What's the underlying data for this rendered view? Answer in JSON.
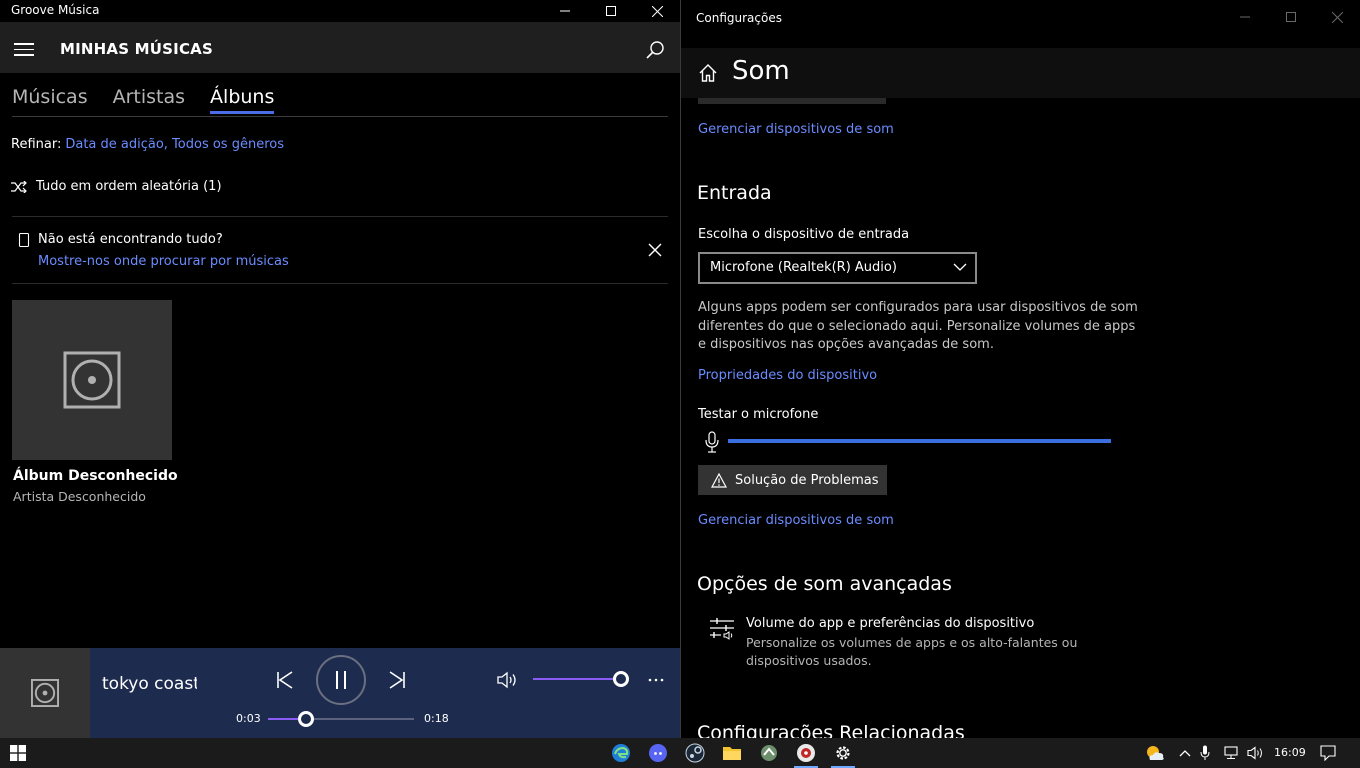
{
  "groove": {
    "window_title": "Groove Música",
    "header_title": "MINHAS MÚSICAS",
    "tabs": [
      "Músicas",
      "Artistas",
      "Álbuns"
    ],
    "refine_label": "Refinar:",
    "refine_value": "Data de adição, Todos os gêneros",
    "shuffle_label": "Tudo em ordem aleatória (1)",
    "notice_question": "Não está encontrando tudo?",
    "notice_link": "Mostre-nos onde procurar por músicas",
    "album": {
      "title": "Álbum Desconhecido",
      "artist": "Artista Desconhecido"
    },
    "player": {
      "track": "tokyo coaste",
      "elapsed": "0:03",
      "duration": "0:18",
      "progress": 0.26,
      "volume": 1.0
    }
  },
  "settings": {
    "window_title": "Configurações",
    "page_title": "Som",
    "manage_link_1": "Gerenciar dispositivos de som",
    "input_heading": "Entrada",
    "input_label": "Escolha o dispositivo de entrada",
    "input_device": "Microfone (Realtek(R) Audio)",
    "info_text": "Alguns apps podem ser configurados para usar dispositivos de som diferentes do que o selecionado aqui. Personalize volumes de apps e dispositivos nas opções avançadas de som.",
    "device_props_link": "Propriedades do dispositivo",
    "test_mic_label": "Testar o microfone",
    "troubleshoot_label": "Solução de Problemas",
    "manage_link_2": "Gerenciar dispositivos de som",
    "advanced_heading": "Opções de som avançadas",
    "advanced_item_title": "Volume do app e preferências do dispositivo",
    "advanced_item_desc": "Personalize os volumes de apps e os alto-falantes ou dispositivos usados.",
    "related_heading": "Configurações Relacionadas"
  },
  "taskbar": {
    "time": "16:09"
  },
  "colors": {
    "accent": "#4a6ce6",
    "link": "#6b8cff",
    "player_bg": "#1c2b4e",
    "slider_fill": "#8b5cf6"
  }
}
